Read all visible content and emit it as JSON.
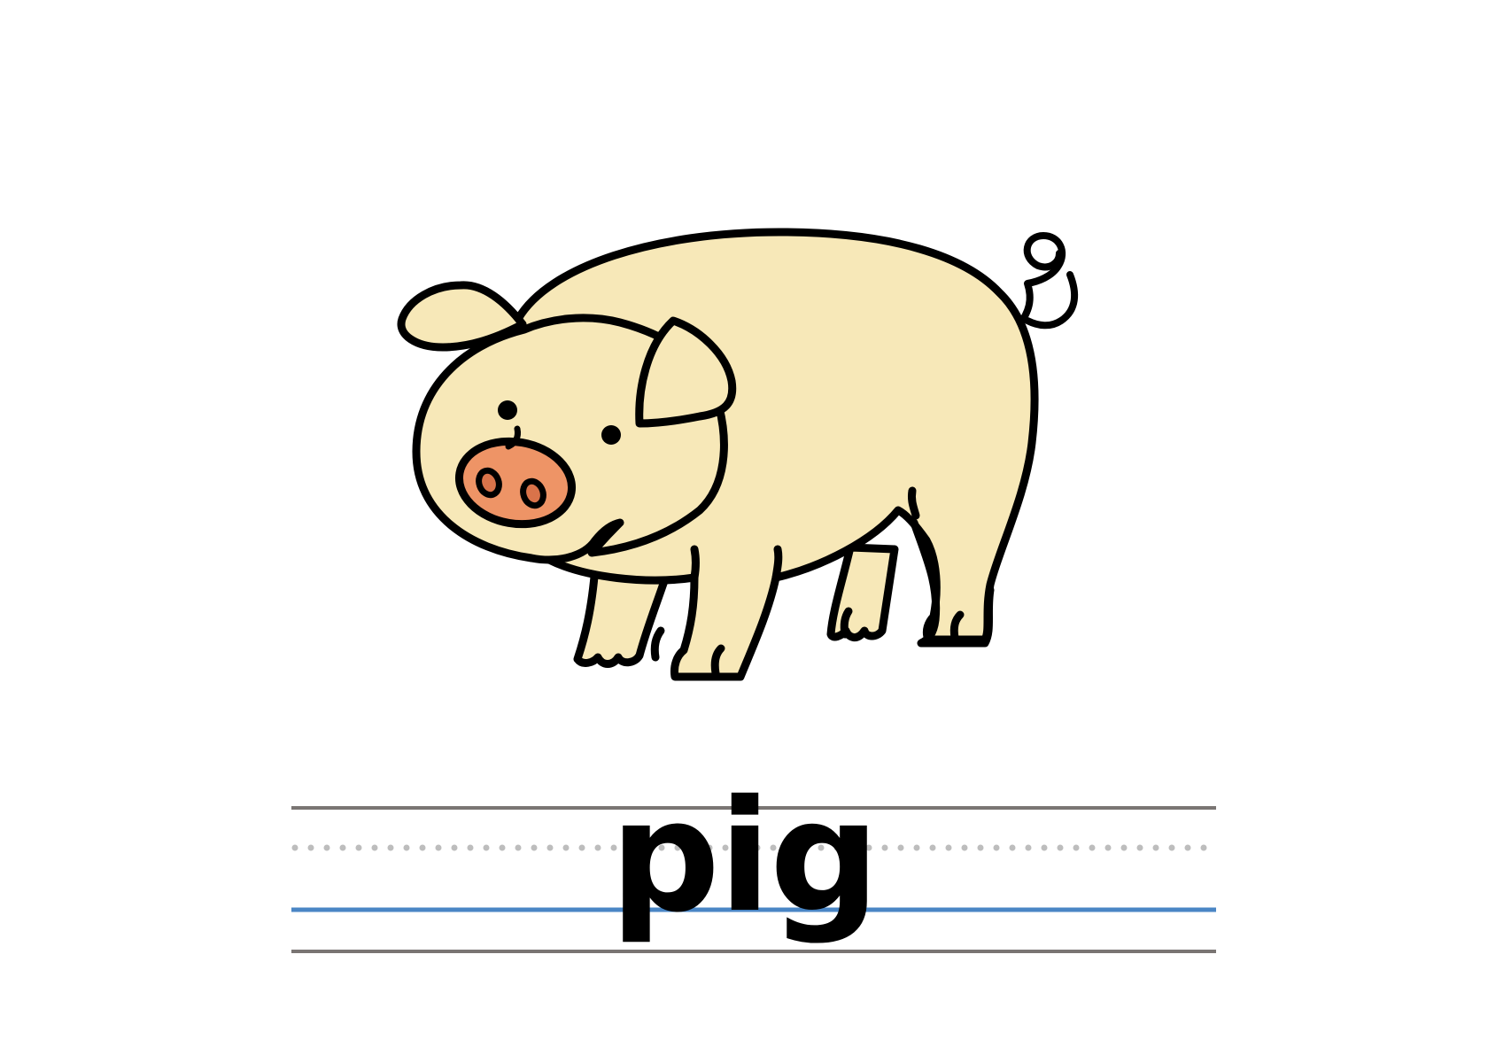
{
  "word": "pig",
  "picture": "pig-illustration",
  "colors": {
    "pig_body": "#F7E8B8",
    "pig_snout": "#EE9466",
    "outline": "#000000",
    "guide_line": "#7A7573",
    "dotted_line": "#BDBDBD",
    "base_line": "#4A86C5",
    "background": "#FFFFFF"
  }
}
